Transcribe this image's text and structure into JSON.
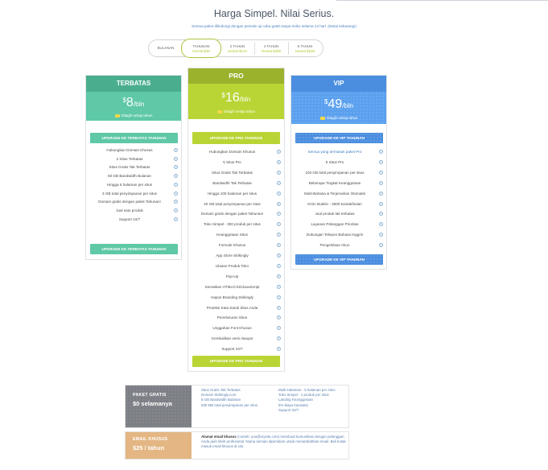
{
  "header": {
    "title": "Harga Simpel. Nilai Serius.",
    "subtitle": "Semua paket dilindungi dengan periode uji coba gratis tanpa risiko selama 14 hari. (Mulai sekarang!)"
  },
  "billing_toggle": [
    {
      "label": "BULANAN",
      "save": ""
    },
    {
      "label": "TAHUNAN",
      "save": "Hemat $48"
    },
    {
      "label": "2 TAHUN",
      "save": "Hemat $144"
    },
    {
      "label": "4 TAHUN",
      "save": "Hemat $288"
    },
    {
      "label": "5 TAHUN",
      "save": "Hemat $528"
    }
  ],
  "plans": [
    {
      "name": "TERBATAS",
      "currency": "$",
      "amount": "8",
      "period": "/bln",
      "billed_note": "Ditagih setiap tahun",
      "cta_top": "UPGRADE KE TERBATAS TAHUNAN",
      "cta_bottom": "UPGRADE KE TERBATAS TAHUNAN",
      "colors": {
        "header": "#4aae8e",
        "price": "#5fc8a6",
        "button": "#5fc8a6"
      },
      "features": [
        "Hubungkan Domain Khusus",
        "2 Situs Terbatas",
        "Situs Gratis Tak Terbatas",
        "50 GB Bandwidth Bulanan",
        "Hingga 5 halaman per situs",
        "3 GB total penyimpanan per situs",
        "Domain gratis dengan paket Tahunan!",
        "Jual satu produk",
        "Support 24/7"
      ]
    },
    {
      "name": "PRO",
      "currency": "$",
      "amount": "16",
      "period": "/bln",
      "billed_note": "Ditagih setiap tahun",
      "cta_top": "UPGRADE KE PRO TAHUNAN",
      "cta_bottom": "UPGRADE KE PRO TAHUNAN",
      "colors": {
        "header": "#9ab22c",
        "price": "#b9d535",
        "button": "#b9d535"
      },
      "features": [
        "Hubungkan Domain Khusus",
        "5 Situs Pro",
        "Situs Gratis Tak Terbatas",
        "Bandwidth Tak Terbatas",
        "Hingga 100 halaman per situs",
        "20 GB total penyimpanan per situs",
        "Domain gratis dengan paket Tahunan!",
        "Toko Simpel - 300 produk per situs",
        "Keanggotaan Situs",
        "Formulir Khusus",
        "App Store Strikingly",
        "Ulasan Produk Toko",
        "Pop-Up",
        "Sematkan HTML/CSS/JavaScript",
        "Hapus Branding Strikingly",
        "Proteksi Kata Sandi Situs Anda",
        "Penelusuran Situs",
        "Unggahan Font Khusus",
        "Kembalikan versi riwayat",
        "Support 24/7"
      ]
    },
    {
      "name": "VIP",
      "currency": "$",
      "amount": "49",
      "period": "/bln",
      "billed_note": "Ditagih setiap tahun",
      "cta_top": "UPGRADE KE VIP TAHUNAN",
      "cta_bottom": "UPGRADE KE VIP TAHUNAN",
      "colors": {
        "header": "#4b8ee0",
        "price": "#5aa0ef",
        "button": "#4b8ee0"
      },
      "features": [
        "Semua yang termasuk paket Pro",
        "5 Situs Pro",
        "100 GB total penyimpanan per situs",
        "Beberapa Tingkat Keanggotaan",
        "Multi-Bahasa & Terjemahan Otomatis",
        "Kirim Buletin - 3000 kontak/bulan",
        "Jual produk tak terbatas",
        "Layanan Pelanggan Prioritas",
        "Dukungan Telepon Bahasa Inggris",
        "Pengelolaan Akun"
      ]
    }
  ],
  "free_plan": {
    "name": "PAKET GRATIS",
    "price": "$0 selamanya",
    "color": "#7d7f86",
    "col1": [
      "Situs Gratis Tak Terbatas",
      "Domain Strikingly.com",
      "5 GB Bandwidth Bulanan",
      "500 MB total penyimpanan per situs"
    ],
    "col2": [
      "Multi-Halaman - 5 halaman per situs",
      "Toko Simpel - 1 produk per situs",
      "Landing Keanggotaan",
      "5% biaya transaksi",
      "Support 24/7"
    ]
  },
  "custom_email": {
    "name": "EMAIL KHUSUS",
    "price": "$25 / tahun",
    "color": "#e3b683",
    "title": "Alamat email khusus",
    "text": "(contoh: you@mysite.com) membuat komunikasi dengan pelanggan Anda jauh lebih profesional. Nama domain diperlukan untuk menambahkan email. Beli kotak masuk email khusus di sini."
  }
}
